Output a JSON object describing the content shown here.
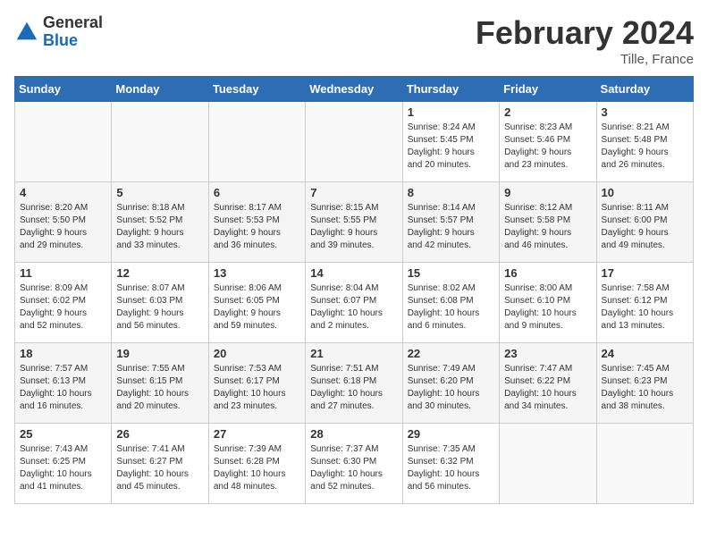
{
  "header": {
    "logo_general": "General",
    "logo_blue": "Blue",
    "month_year": "February 2024",
    "location": "Tille, France"
  },
  "days_of_week": [
    "Sunday",
    "Monday",
    "Tuesday",
    "Wednesday",
    "Thursday",
    "Friday",
    "Saturday"
  ],
  "weeks": [
    [
      {
        "day": "",
        "info": ""
      },
      {
        "day": "",
        "info": ""
      },
      {
        "day": "",
        "info": ""
      },
      {
        "day": "",
        "info": ""
      },
      {
        "day": "1",
        "info": "Sunrise: 8:24 AM\nSunset: 5:45 PM\nDaylight: 9 hours\nand 20 minutes."
      },
      {
        "day": "2",
        "info": "Sunrise: 8:23 AM\nSunset: 5:46 PM\nDaylight: 9 hours\nand 23 minutes."
      },
      {
        "day": "3",
        "info": "Sunrise: 8:21 AM\nSunset: 5:48 PM\nDaylight: 9 hours\nand 26 minutes."
      }
    ],
    [
      {
        "day": "4",
        "info": "Sunrise: 8:20 AM\nSunset: 5:50 PM\nDaylight: 9 hours\nand 29 minutes."
      },
      {
        "day": "5",
        "info": "Sunrise: 8:18 AM\nSunset: 5:52 PM\nDaylight: 9 hours\nand 33 minutes."
      },
      {
        "day": "6",
        "info": "Sunrise: 8:17 AM\nSunset: 5:53 PM\nDaylight: 9 hours\nand 36 minutes."
      },
      {
        "day": "7",
        "info": "Sunrise: 8:15 AM\nSunset: 5:55 PM\nDaylight: 9 hours\nand 39 minutes."
      },
      {
        "day": "8",
        "info": "Sunrise: 8:14 AM\nSunset: 5:57 PM\nDaylight: 9 hours\nand 42 minutes."
      },
      {
        "day": "9",
        "info": "Sunrise: 8:12 AM\nSunset: 5:58 PM\nDaylight: 9 hours\nand 46 minutes."
      },
      {
        "day": "10",
        "info": "Sunrise: 8:11 AM\nSunset: 6:00 PM\nDaylight: 9 hours\nand 49 minutes."
      }
    ],
    [
      {
        "day": "11",
        "info": "Sunrise: 8:09 AM\nSunset: 6:02 PM\nDaylight: 9 hours\nand 52 minutes."
      },
      {
        "day": "12",
        "info": "Sunrise: 8:07 AM\nSunset: 6:03 PM\nDaylight: 9 hours\nand 56 minutes."
      },
      {
        "day": "13",
        "info": "Sunrise: 8:06 AM\nSunset: 6:05 PM\nDaylight: 9 hours\nand 59 minutes."
      },
      {
        "day": "14",
        "info": "Sunrise: 8:04 AM\nSunset: 6:07 PM\nDaylight: 10 hours\nand 2 minutes."
      },
      {
        "day": "15",
        "info": "Sunrise: 8:02 AM\nSunset: 6:08 PM\nDaylight: 10 hours\nand 6 minutes."
      },
      {
        "day": "16",
        "info": "Sunrise: 8:00 AM\nSunset: 6:10 PM\nDaylight: 10 hours\nand 9 minutes."
      },
      {
        "day": "17",
        "info": "Sunrise: 7:58 AM\nSunset: 6:12 PM\nDaylight: 10 hours\nand 13 minutes."
      }
    ],
    [
      {
        "day": "18",
        "info": "Sunrise: 7:57 AM\nSunset: 6:13 PM\nDaylight: 10 hours\nand 16 minutes."
      },
      {
        "day": "19",
        "info": "Sunrise: 7:55 AM\nSunset: 6:15 PM\nDaylight: 10 hours\nand 20 minutes."
      },
      {
        "day": "20",
        "info": "Sunrise: 7:53 AM\nSunset: 6:17 PM\nDaylight: 10 hours\nand 23 minutes."
      },
      {
        "day": "21",
        "info": "Sunrise: 7:51 AM\nSunset: 6:18 PM\nDaylight: 10 hours\nand 27 minutes."
      },
      {
        "day": "22",
        "info": "Sunrise: 7:49 AM\nSunset: 6:20 PM\nDaylight: 10 hours\nand 30 minutes."
      },
      {
        "day": "23",
        "info": "Sunrise: 7:47 AM\nSunset: 6:22 PM\nDaylight: 10 hours\nand 34 minutes."
      },
      {
        "day": "24",
        "info": "Sunrise: 7:45 AM\nSunset: 6:23 PM\nDaylight: 10 hours\nand 38 minutes."
      }
    ],
    [
      {
        "day": "25",
        "info": "Sunrise: 7:43 AM\nSunset: 6:25 PM\nDaylight: 10 hours\nand 41 minutes."
      },
      {
        "day": "26",
        "info": "Sunrise: 7:41 AM\nSunset: 6:27 PM\nDaylight: 10 hours\nand 45 minutes."
      },
      {
        "day": "27",
        "info": "Sunrise: 7:39 AM\nSunset: 6:28 PM\nDaylight: 10 hours\nand 48 minutes."
      },
      {
        "day": "28",
        "info": "Sunrise: 7:37 AM\nSunset: 6:30 PM\nDaylight: 10 hours\nand 52 minutes."
      },
      {
        "day": "29",
        "info": "Sunrise: 7:35 AM\nSunset: 6:32 PM\nDaylight: 10 hours\nand 56 minutes."
      },
      {
        "day": "",
        "info": ""
      },
      {
        "day": "",
        "info": ""
      }
    ]
  ]
}
